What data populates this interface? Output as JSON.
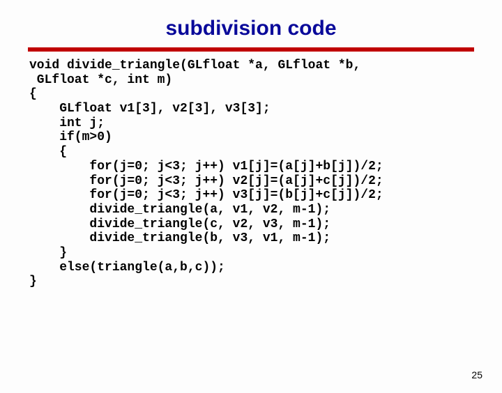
{
  "title": "subdivision code",
  "code": "void divide_triangle(GLfloat *a, GLfloat *b,\n GLfloat *c, int m)\n{\n    GLfloat v1[3], v2[3], v3[3];\n    int j;\n    if(m>0)\n    {\n        for(j=0; j<3; j++) v1[j]=(a[j]+b[j])/2;\n        for(j=0; j<3; j++) v2[j]=(a[j]+c[j])/2;\n        for(j=0; j<3; j++) v3[j]=(b[j]+c[j])/2;\n        divide_triangle(a, v1, v2, m-1);\n        divide_triangle(c, v2, v3, m-1);\n        divide_triangle(b, v3, v1, m-1);\n    }\n    else(triangle(a,b,c));\n}",
  "pagenum": "25"
}
